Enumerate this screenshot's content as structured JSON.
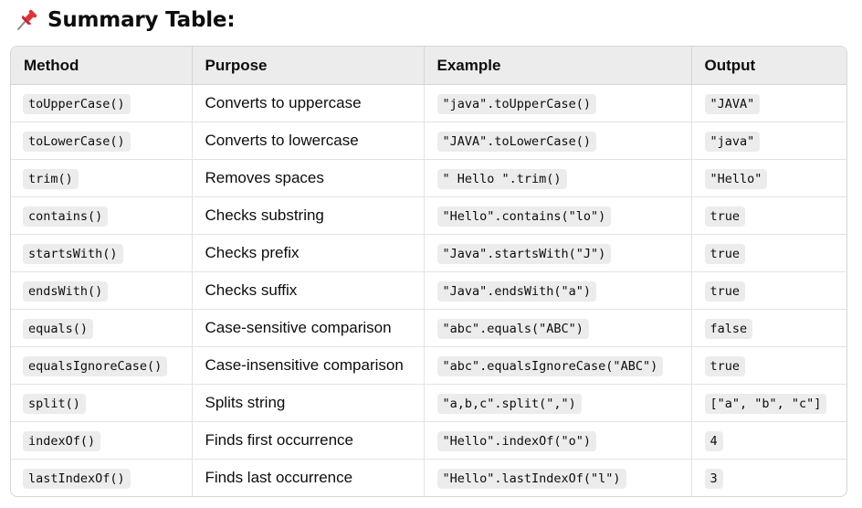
{
  "heading": {
    "icon": "pushpin-icon",
    "text": "Summary Table:"
  },
  "colors": {
    "pin_red": "#e0343a",
    "header_bg": "#ececec",
    "code_bg": "#ececec",
    "border": "#d6d6d6"
  },
  "table": {
    "headers": [
      "Method",
      "Purpose",
      "Example",
      "Output"
    ],
    "rows": [
      {
        "method": "toUpperCase()",
        "purpose": "Converts to uppercase",
        "example": "\"java\".toUpperCase()",
        "output": "\"JAVA\""
      },
      {
        "method": "toLowerCase()",
        "purpose": "Converts to lowercase",
        "example": "\"JAVA\".toLowerCase()",
        "output": "\"java\""
      },
      {
        "method": "trim()",
        "purpose": "Removes spaces",
        "example": "\" Hello \".trim()",
        "output": "\"Hello\""
      },
      {
        "method": "contains()",
        "purpose": "Checks substring",
        "example": "\"Hello\".contains(\"lo\")",
        "output": "true"
      },
      {
        "method": "startsWith()",
        "purpose": "Checks prefix",
        "example": "\"Java\".startsWith(\"J\")",
        "output": "true"
      },
      {
        "method": "endsWith()",
        "purpose": "Checks suffix",
        "example": "\"Java\".endsWith(\"a\")",
        "output": "true"
      },
      {
        "method": "equals()",
        "purpose": "Case-sensitive comparison",
        "example": "\"abc\".equals(\"ABC\")",
        "output": "false"
      },
      {
        "method": "equalsIgnoreCase()",
        "purpose": "Case-insensitive comparison",
        "example": "\"abc\".equalsIgnoreCase(\"ABC\")",
        "output": "true"
      },
      {
        "method": "split()",
        "purpose": "Splits string",
        "example": "\"a,b,c\".split(\",\")",
        "output": "[\"a\", \"b\", \"c\"]"
      },
      {
        "method": "indexOf()",
        "purpose": "Finds first occurrence",
        "example": "\"Hello\".indexOf(\"o\")",
        "output": "4"
      },
      {
        "method": "lastIndexOf()",
        "purpose": "Finds last occurrence",
        "example": "\"Hello\".lastIndexOf(\"l\")",
        "output": "3"
      }
    ]
  }
}
